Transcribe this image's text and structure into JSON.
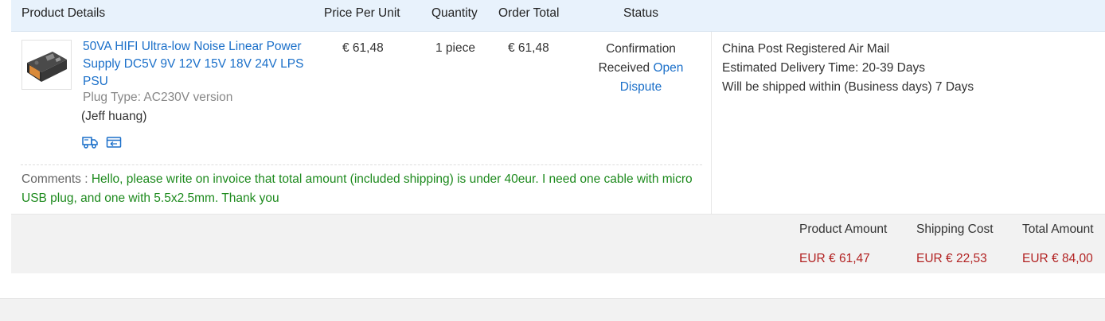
{
  "header": {
    "product_details": "Product Details",
    "price_per_unit": "Price Per Unit",
    "quantity": "Quantity",
    "order_total": "Order Total",
    "status": "Status"
  },
  "item": {
    "name": "50VA HIFI Ultra-low Noise Linear Power Supply DC5V 9V 12V 15V 18V 24V LPS PSU",
    "attribute": "Plug Type: AC230V version",
    "seller": "(Jeff huang)",
    "icons": [
      "truck-icon",
      "return-icon"
    ],
    "price_per_unit": "€ 61,48",
    "quantity": "1 piece",
    "order_total": "€ 61,48",
    "status_text": "Confirmation Received",
    "status_link": "Open Dispute"
  },
  "shipping": {
    "method": "China Post Registered Air Mail",
    "delivery": "Estimated Delivery Time:  20-39 Days",
    "ship_within": "Will be shipped within (Business days)  7 Days"
  },
  "comments": {
    "label": "Comments : ",
    "text": "Hello, please write on invoice that total amount (included shipping) is under 40eur. I need one cable with micro USB plug, and one with 5.5x2.5mm. Thank you"
  },
  "totals": {
    "product_amount_label": "Product Amount",
    "product_amount": "EUR € 61,47",
    "shipping_cost_label": "Shipping Cost",
    "shipping_cost": "EUR € 22,53",
    "total_amount_label": "Total Amount",
    "total_amount": "EUR € 84,00"
  },
  "colors": {
    "link": "#1a6fc9",
    "comment": "#1d8a1d",
    "amount": "#b22222",
    "header_bg": "#e8f2fc"
  }
}
